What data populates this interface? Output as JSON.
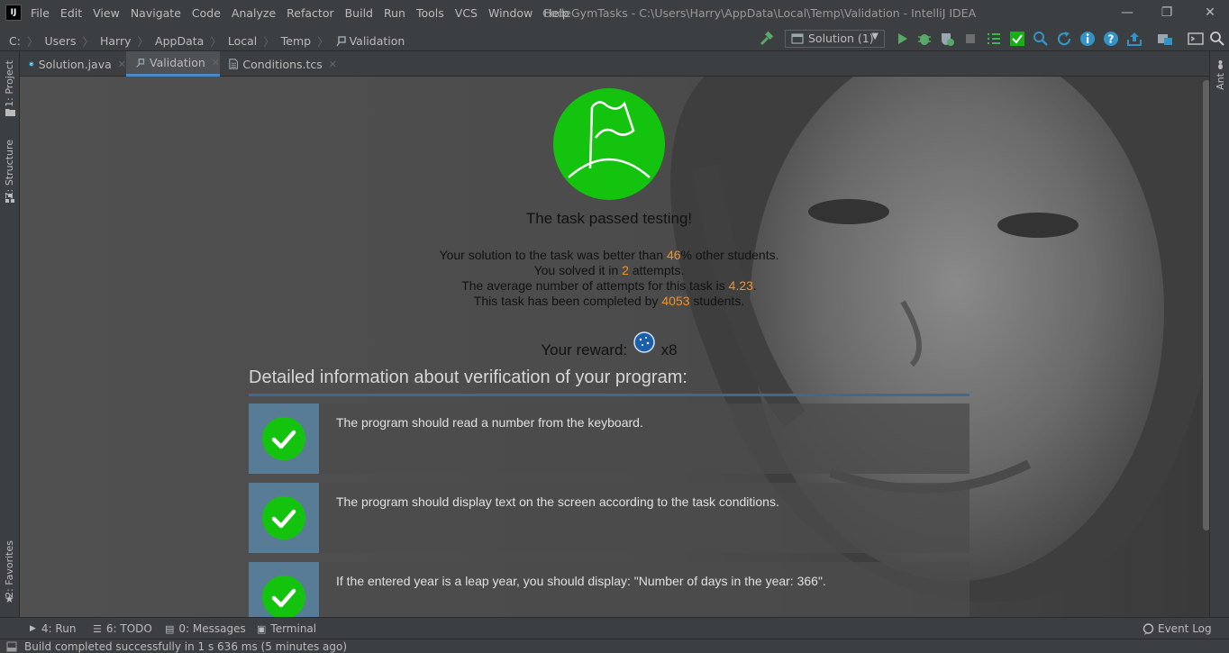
{
  "window": {
    "logo": "IJ",
    "title": "CodeGymTasks - C:\\Users\\Harry\\AppData\\Local\\Temp\\Validation - IntelliJ IDEA",
    "minimize": "—",
    "restore": "❐",
    "close": "✕"
  },
  "menu": [
    "File",
    "Edit",
    "View",
    "Navigate",
    "Code",
    "Analyze",
    "Refactor",
    "Build",
    "Run",
    "Tools",
    "VCS",
    "Window",
    "Help"
  ],
  "breadcrumbs": [
    "C:",
    "Users",
    "Harry",
    "AppData",
    "Local",
    "Temp",
    "Validation"
  ],
  "toolbar": {
    "run_config": "Solution (1)",
    "icons": [
      "build-hammer-icon",
      "run-icon",
      "debug-icon",
      "coverage-icon",
      "stop-icon",
      "task-list-icon",
      "check-task-icon",
      "search-task-icon",
      "refresh-icon",
      "info-icon",
      "help-icon",
      "upload-icon",
      "project-structure-icon",
      "terminal-icon",
      "search-everywhere-icon"
    ]
  },
  "colors": {
    "accent": "#4a88c7",
    "success": "#14c30e",
    "highlight": "#f0932b",
    "panel": "#587b96"
  },
  "left_tool_windows": {
    "project": "1: Project",
    "structure": "Z: Structure",
    "favorites": "2: Favorites"
  },
  "right_tool_windows": {
    "ant": "Ant"
  },
  "tabs": [
    {
      "label": "Solution.java",
      "icon": "java-class-icon"
    },
    {
      "label": "Validation",
      "icon": "validation-icon",
      "active": true
    },
    {
      "label": "Conditions.tcs",
      "icon": "document-icon"
    }
  ],
  "result": {
    "headline": "The task passed testing!",
    "stats": [
      {
        "pre": "Your solution to the task was better than ",
        "value": "46",
        "post": "% other students."
      },
      {
        "pre": "You solved it in ",
        "value": "2",
        "post": " attempts."
      },
      {
        "pre": "The average number of attempts for this task is ",
        "value": "4.23",
        "post": "."
      },
      {
        "pre": "This task has been completed by ",
        "value": "4053",
        "post": " students."
      }
    ],
    "reward_label": "Your reward:",
    "reward_count": "x8"
  },
  "details": {
    "title": "Detailed information about verification of your program:",
    "checks": [
      "The program should read a number from the keyboard.",
      "The program should display text on the screen according to the task conditions.",
      "If the entered year is a leap year, you should display: \"Number of days in the year: 366\"."
    ]
  },
  "bottom_tool_windows": [
    {
      "label": "4: Run",
      "icon": "run-icon"
    },
    {
      "label": "6: TODO",
      "icon": "todo-icon"
    },
    {
      "label": "0: Messages",
      "icon": "messages-icon"
    },
    {
      "label": "Terminal",
      "icon": "terminal-icon"
    }
  ],
  "event_log": "Event Log",
  "status": "Build completed successfully in 1 s 636 ms (5 minutes ago)"
}
